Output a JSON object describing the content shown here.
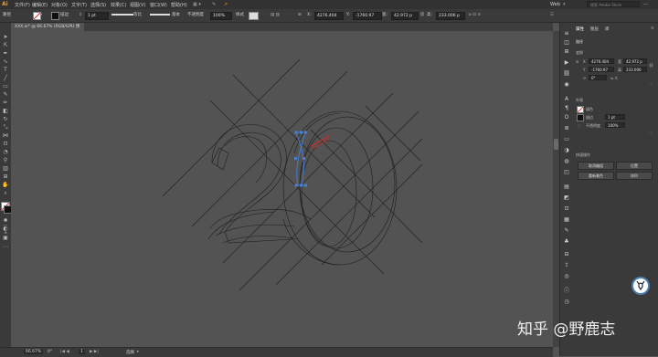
{
  "app": {
    "logo": "Ai",
    "workspace": "Web",
    "search_placeholder": "搜索 Adobe Stock"
  },
  "menu": [
    "文件(F)",
    "编辑(E)",
    "对象(O)",
    "文字(T)",
    "选择(S)",
    "效果(C)",
    "视图(V)",
    "窗口(W)",
    "帮助(H)"
  ],
  "control_bar": {
    "selection_label": "路径",
    "stroke_label": "描边",
    "stroke_weight": "1 pt",
    "profile_label": "等比",
    "brush_label": "基本",
    "opacity_label": "不透明度",
    "opacity_value": "100%",
    "style_label": "样式",
    "x_value": "4276.404",
    "y_value": "-1760.97",
    "w_value": "42.972 p",
    "h_value": "233.006 p"
  },
  "document_tab": {
    "title": "XXX.ai* @ 66.67% (RGB/GPU 预览)"
  },
  "properties_panel": {
    "tabs": [
      "属性",
      "图层",
      "库"
    ],
    "section_path": "路径",
    "section_transform": "变换",
    "x_label": "X",
    "y_label": "Y",
    "w_label": "宽",
    "h_label": "高",
    "x_value": "4276.404",
    "y_value": "-1760.97",
    "w_value": "42.972 p",
    "h_value": "233.006",
    "rotate_value": "0°",
    "section_appearance": "外观",
    "fill_label": "填色",
    "stroke_label": "描边",
    "stroke_weight": "1 pt",
    "opacity_label": "不透明度",
    "opacity_value": "100%",
    "quick_actions_label": "快速操作",
    "quick_actions": [
      "取消编组",
      "位置",
      "重新着色",
      "排列"
    ]
  },
  "status_bar": {
    "zoom": "66.67%",
    "angle": "0°",
    "page": "1",
    "tool": "选择"
  },
  "watermark": "知乎 @野鹿志",
  "colors": {
    "accent_selection": "#4a7fd6",
    "handle_red": "#d02a2a",
    "canvas": "#535353",
    "chrome": "#3a3a3a"
  }
}
